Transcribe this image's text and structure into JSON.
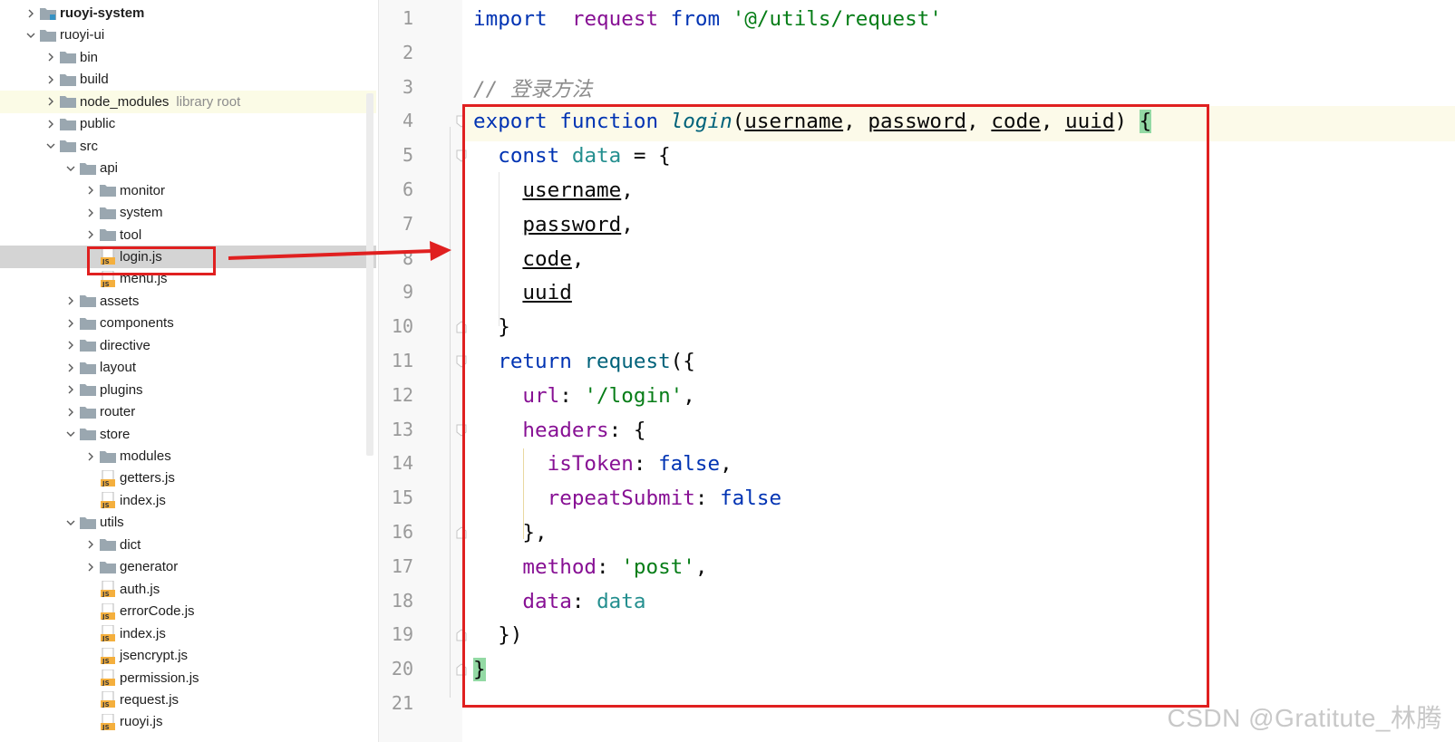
{
  "tree": {
    "items": [
      {
        "label": "ruoyi-system",
        "depth": 0,
        "type": "module",
        "expanded": false,
        "bold": true
      },
      {
        "label": "ruoyi-ui",
        "depth": 0,
        "type": "folder",
        "expanded": true
      },
      {
        "label": "bin",
        "depth": 1,
        "type": "folder",
        "expanded": false
      },
      {
        "label": "build",
        "depth": 1,
        "type": "folder",
        "expanded": false
      },
      {
        "label": "node_modules",
        "depth": 1,
        "type": "folder",
        "expanded": false,
        "suffix": "library root",
        "highlight": "yellow"
      },
      {
        "label": "public",
        "depth": 1,
        "type": "folder",
        "expanded": false
      },
      {
        "label": "src",
        "depth": 1,
        "type": "folder",
        "expanded": true
      },
      {
        "label": "api",
        "depth": 2,
        "type": "folder",
        "expanded": true
      },
      {
        "label": "monitor",
        "depth": 3,
        "type": "folder",
        "expanded": false
      },
      {
        "label": "system",
        "depth": 3,
        "type": "folder",
        "expanded": false
      },
      {
        "label": "tool",
        "depth": 3,
        "type": "folder",
        "expanded": false
      },
      {
        "label": "login.js",
        "depth": 3,
        "type": "js",
        "selected": true
      },
      {
        "label": "menu.js",
        "depth": 3,
        "type": "js"
      },
      {
        "label": "assets",
        "depth": 2,
        "type": "folder",
        "expanded": false
      },
      {
        "label": "components",
        "depth": 2,
        "type": "folder",
        "expanded": false
      },
      {
        "label": "directive",
        "depth": 2,
        "type": "folder",
        "expanded": false
      },
      {
        "label": "layout",
        "depth": 2,
        "type": "folder",
        "expanded": false
      },
      {
        "label": "plugins",
        "depth": 2,
        "type": "folder",
        "expanded": false
      },
      {
        "label": "router",
        "depth": 2,
        "type": "folder",
        "expanded": false
      },
      {
        "label": "store",
        "depth": 2,
        "type": "folder",
        "expanded": true
      },
      {
        "label": "modules",
        "depth": 3,
        "type": "folder",
        "expanded": false
      },
      {
        "label": "getters.js",
        "depth": 3,
        "type": "js"
      },
      {
        "label": "index.js",
        "depth": 3,
        "type": "js"
      },
      {
        "label": "utils",
        "depth": 2,
        "type": "folder",
        "expanded": true
      },
      {
        "label": "dict",
        "depth": 3,
        "type": "folder",
        "expanded": false
      },
      {
        "label": "generator",
        "depth": 3,
        "type": "folder",
        "expanded": false
      },
      {
        "label": "auth.js",
        "depth": 3,
        "type": "js"
      },
      {
        "label": "errorCode.js",
        "depth": 3,
        "type": "js"
      },
      {
        "label": "index.js",
        "depth": 3,
        "type": "js"
      },
      {
        "label": "jsencrypt.js",
        "depth": 3,
        "type": "js"
      },
      {
        "label": "permission.js",
        "depth": 3,
        "type": "js"
      },
      {
        "label": "request.js",
        "depth": 3,
        "type": "js"
      },
      {
        "label": "ruoyi.js",
        "depth": 3,
        "type": "js"
      }
    ]
  },
  "editor": {
    "lines": [
      {
        "n": "1",
        "tokens": [
          [
            "kw",
            "import"
          ],
          [
            "",
            "  "
          ],
          [
            "prop",
            "request"
          ],
          [
            "",
            " "
          ],
          [
            "kw",
            "from"
          ],
          [
            "",
            " "
          ],
          [
            "str",
            "'@/utils/request'"
          ]
        ]
      },
      {
        "n": "2",
        "tokens": []
      },
      {
        "n": "3",
        "tokens": [
          [
            "cm",
            "// 登录方法"
          ]
        ]
      },
      {
        "n": "4",
        "tokens": [
          [
            "kw",
            "export"
          ],
          [
            "",
            " "
          ],
          [
            "kw",
            "function"
          ],
          [
            "",
            " "
          ],
          [
            "fn",
            "login"
          ],
          [
            "",
            "("
          ],
          [
            "param",
            "username"
          ],
          [
            "",
            ", "
          ],
          [
            "param",
            "password"
          ],
          [
            "",
            ", "
          ],
          [
            "param",
            "code"
          ],
          [
            "",
            ", "
          ],
          [
            "param",
            "uuid"
          ],
          [
            "",
            ") "
          ],
          [
            "match",
            "{"
          ]
        ]
      },
      {
        "n": "5",
        "tokens": [
          [
            "",
            "  "
          ],
          [
            "kw",
            "const"
          ],
          [
            "",
            " "
          ],
          [
            "tealv",
            "data"
          ],
          [
            "",
            " = {"
          ]
        ]
      },
      {
        "n": "6",
        "tokens": [
          [
            "",
            "    "
          ],
          [
            "param",
            "username"
          ],
          [
            "",
            ","
          ]
        ]
      },
      {
        "n": "7",
        "tokens": [
          [
            "",
            "    "
          ],
          [
            "param",
            "password"
          ],
          [
            "",
            ","
          ]
        ]
      },
      {
        "n": "8",
        "tokens": [
          [
            "",
            "    "
          ],
          [
            "param",
            "code"
          ],
          [
            "",
            ","
          ]
        ]
      },
      {
        "n": "9",
        "tokens": [
          [
            "",
            "    "
          ],
          [
            "param",
            "uuid"
          ]
        ]
      },
      {
        "n": "10",
        "tokens": [
          [
            "",
            "  }"
          ]
        ]
      },
      {
        "n": "11",
        "tokens": [
          [
            "",
            "  "
          ],
          [
            "kw",
            "return"
          ],
          [
            "",
            " "
          ],
          [
            "fn-call",
            "request"
          ],
          [
            "",
            "({"
          ]
        ]
      },
      {
        "n": "12",
        "tokens": [
          [
            "",
            "    "
          ],
          [
            "prop",
            "url"
          ],
          [
            "",
            ": "
          ],
          [
            "str",
            "'/login'"
          ],
          [
            "",
            ","
          ]
        ]
      },
      {
        "n": "13",
        "tokens": [
          [
            "",
            "    "
          ],
          [
            "prop",
            "headers"
          ],
          [
            "",
            ": {"
          ]
        ]
      },
      {
        "n": "14",
        "tokens": [
          [
            "",
            "      "
          ],
          [
            "prop",
            "isToken"
          ],
          [
            "",
            ": "
          ],
          [
            "kw",
            "false"
          ],
          [
            "",
            ","
          ]
        ]
      },
      {
        "n": "15",
        "tokens": [
          [
            "",
            "      "
          ],
          [
            "prop",
            "repeatSubmit"
          ],
          [
            "",
            ": "
          ],
          [
            "kw",
            "false"
          ]
        ]
      },
      {
        "n": "16",
        "tokens": [
          [
            "",
            "    },"
          ]
        ]
      },
      {
        "n": "17",
        "tokens": [
          [
            "",
            "    "
          ],
          [
            "prop",
            "method"
          ],
          [
            "",
            ": "
          ],
          [
            "str",
            "'post'"
          ],
          [
            "",
            ","
          ]
        ]
      },
      {
        "n": "18",
        "tokens": [
          [
            "",
            "    "
          ],
          [
            "prop",
            "data"
          ],
          [
            "",
            ": "
          ],
          [
            "tealv",
            "data"
          ]
        ]
      },
      {
        "n": "19",
        "tokens": [
          [
            "",
            "  })"
          ]
        ]
      },
      {
        "n": "20",
        "tokens": [
          [
            "match",
            "}"
          ]
        ]
      },
      {
        "n": "21",
        "tokens": []
      }
    ]
  },
  "watermark": "CSDN @Gratitute_林腾",
  "colors": {
    "annotation": "#e02020",
    "keyword": "#0033b3",
    "string": "#067d17",
    "property": "#871094"
  }
}
